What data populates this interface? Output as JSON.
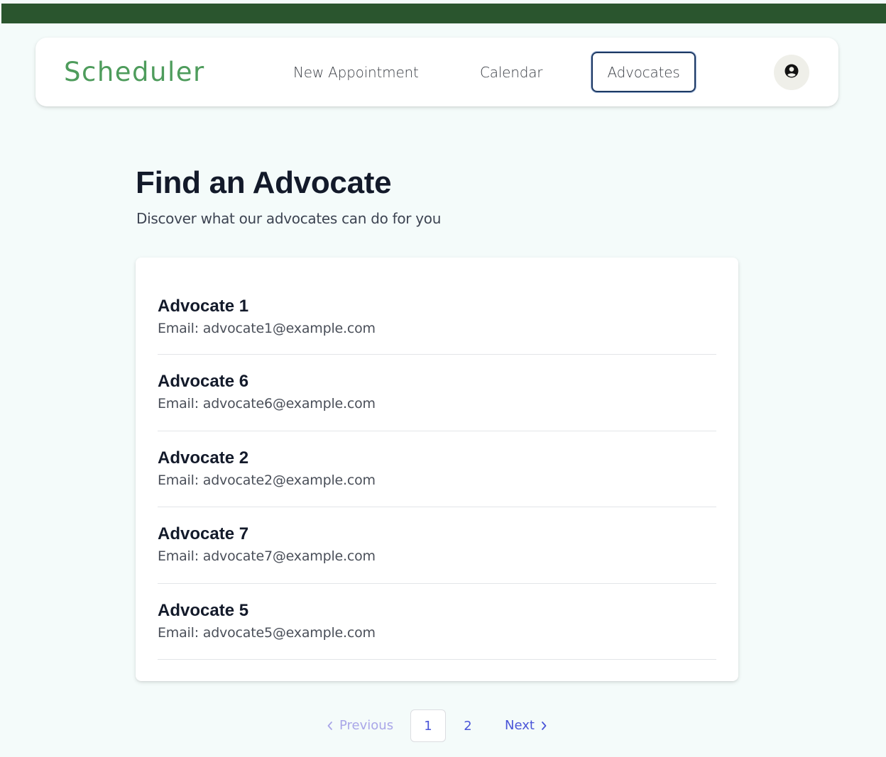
{
  "header": {
    "brand": "Scheduler",
    "nav": [
      {
        "label": "New Appointment"
      },
      {
        "label": "Calendar"
      },
      {
        "label": "Advocates",
        "active": true
      }
    ],
    "profile_icon": "user-circle-icon"
  },
  "main": {
    "title": "Find an Advocate",
    "subtitle": "Discover what our advocates can do for you",
    "advocates": [
      {
        "name": "Advocate 1",
        "email": "Email: advocate1@example.com"
      },
      {
        "name": "Advocate 6",
        "email": "Email: advocate6@example.com"
      },
      {
        "name": "Advocate 2",
        "email": "Email: advocate2@example.com"
      },
      {
        "name": "Advocate 7",
        "email": "Email: advocate7@example.com"
      },
      {
        "name": "Advocate 5",
        "email": "Email: advocate5@example.com"
      }
    ]
  },
  "pagination": {
    "previous_label": "Previous",
    "next_label": "Next",
    "pages": [
      "1",
      "2"
    ],
    "current_page": "1"
  },
  "colors": {
    "topbar": "#2a552e",
    "brand": "#4e9c5c",
    "link": "#4a55d8",
    "disabled_link": "#a9a6e8",
    "active_nav_border": "#1e3a64"
  }
}
